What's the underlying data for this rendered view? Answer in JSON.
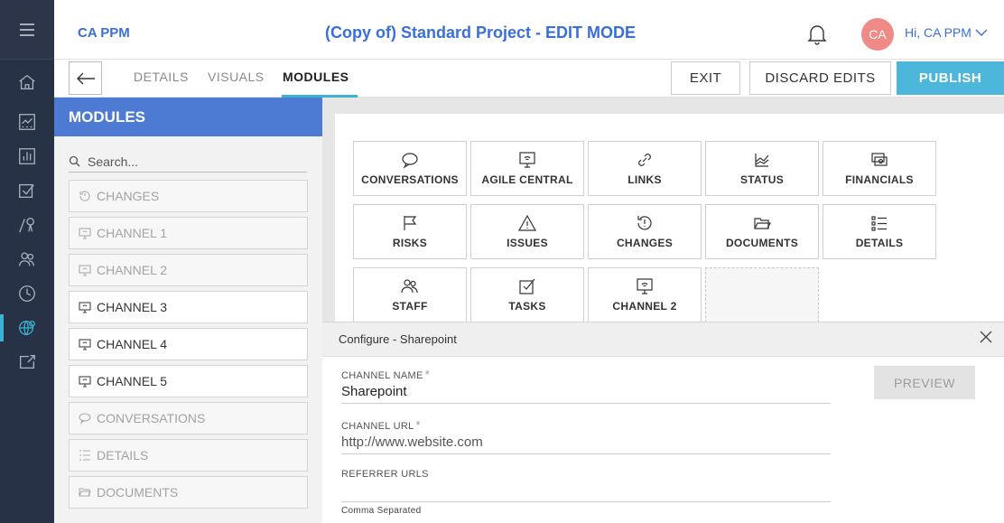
{
  "header": {
    "brand": "CA PPM",
    "title": "(Copy of) Standard Project - EDIT MODE",
    "avatar_initials": "CA",
    "greeting": "Hi, CA PPM"
  },
  "tabs": {
    "details": "DETAILS",
    "visuals": "VISUALS",
    "modules": "MODULES"
  },
  "actions": {
    "exit": "EXIT",
    "discard": "DISCARD EDITS",
    "publish": "PUBLISH"
  },
  "modules_panel": {
    "heading": "MODULES",
    "search_placeholder": "Search...",
    "items": [
      {
        "label": "CHANGES",
        "icon": "changes-icon",
        "dim": true
      },
      {
        "label": "CHANNEL 1",
        "icon": "channel-icon",
        "dim": true
      },
      {
        "label": "CHANNEL 2",
        "icon": "channel-icon",
        "dim": true
      },
      {
        "label": "CHANNEL 3",
        "icon": "channel-icon",
        "dim": false
      },
      {
        "label": "CHANNEL 4",
        "icon": "channel-icon",
        "dim": false
      },
      {
        "label": "CHANNEL 5",
        "icon": "channel-icon",
        "dim": false
      },
      {
        "label": "CONVERSATIONS",
        "icon": "conversations-icon",
        "dim": true
      },
      {
        "label": "DETAILS",
        "icon": "details-icon",
        "dim": true
      },
      {
        "label": "DOCUMENTS",
        "icon": "documents-icon",
        "dim": true
      }
    ]
  },
  "tiles": [
    {
      "label": "CONVERSATIONS",
      "icon": "speech-bubble-icon"
    },
    {
      "label": "AGILE CENTRAL",
      "icon": "monitor-wifi-icon"
    },
    {
      "label": "LINKS",
      "icon": "link-icon"
    },
    {
      "label": "STATUS",
      "icon": "chart-icon"
    },
    {
      "label": "FINANCIALS",
      "icon": "money-icon"
    },
    {
      "label": "RISKS",
      "icon": "flag-icon"
    },
    {
      "label": "ISSUES",
      "icon": "warning-icon"
    },
    {
      "label": "CHANGES",
      "icon": "changes-icon"
    },
    {
      "label": "DOCUMENTS",
      "icon": "folder-icon"
    },
    {
      "label": "DETAILS",
      "icon": "list-icon"
    },
    {
      "label": "STAFF",
      "icon": "people-icon"
    },
    {
      "label": "TASKS",
      "icon": "checkbox-icon"
    },
    {
      "label": "CHANNEL 2",
      "icon": "monitor-wifi-icon"
    }
  ],
  "config": {
    "title": "Configure - Sharepoint",
    "channel_name_label": "CHANNEL NAME",
    "channel_name_value": "Sharepoint",
    "channel_url_label": "CHANNEL URL",
    "channel_url_value": "http://www.website.com",
    "referrer_label": "REFERRER URLS",
    "referrer_value": "",
    "referrer_hint": "Comma Separated",
    "preview": "PREVIEW",
    "required_mark": "*"
  },
  "colors": {
    "rail": "#283246",
    "accent_blue": "#3a6fd8",
    "module_header": "#4d7bd3",
    "publish": "#4cb7db",
    "avatar": "#f08a86"
  }
}
